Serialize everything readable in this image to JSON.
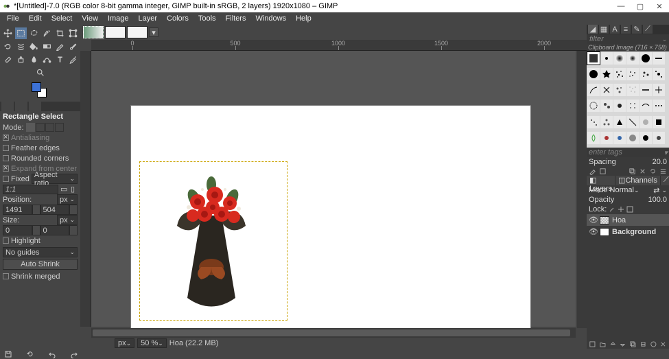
{
  "title": "*[Untitled]-7.0 (RGB color 8-bit gamma integer, GIMP built-in sRGB, 2 layers) 1920x1080 – GIMP",
  "menu": [
    "File",
    "Edit",
    "Select",
    "View",
    "Image",
    "Layer",
    "Colors",
    "Tools",
    "Filters",
    "Windows",
    "Help"
  ],
  "ruler_ticks": [
    "0",
    "500",
    "1000",
    "1500",
    "2000"
  ],
  "tool_options": {
    "header": "Rectangle Select",
    "mode": "Mode:",
    "antialias": "Antialiasing",
    "feather": "Feather edges",
    "rounded": "Rounded corners",
    "expand": "Expand from center",
    "fixed": "Fixed",
    "aspect": "Aspect ratio",
    "ratio": "1:1",
    "position": "Position:",
    "px1": "px",
    "pos_x": "1491",
    "pos_y": "504",
    "size": "Size:",
    "px2": "px",
    "sz_x": "0",
    "sz_y": "0",
    "highlight": "Highlight",
    "guides": "No guides",
    "autoshrink": "Auto Shrink",
    "shrinkmerged": "Shrink merged"
  },
  "right": {
    "filter": "filter",
    "brush_header": "Clipboard Image (716 × 758)",
    "tags": "enter tags",
    "spacing": "Spacing",
    "spacing_val": "20.0",
    "layer_tabs": [
      "Layers",
      "Channels",
      "Paths"
    ],
    "mode": "Mode",
    "mode_val": "Normal",
    "opacity": "Opacity",
    "opacity_val": "100.0",
    "lock": "Lock:",
    "layers": [
      {
        "name": "Hoa",
        "active": true
      },
      {
        "name": "Background",
        "active": false
      }
    ]
  },
  "status": {
    "unit": "px",
    "zoom": "50 %",
    "layer": "Hoa (22.2 MB)"
  }
}
